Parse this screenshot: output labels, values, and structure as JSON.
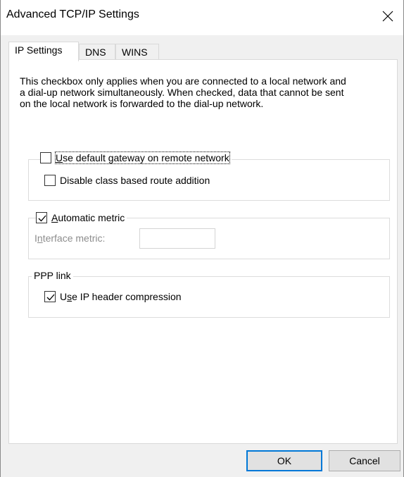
{
  "window": {
    "title": "Advanced TCP/IP Settings",
    "close_icon": "close-icon"
  },
  "tabs": [
    {
      "label": "IP Settings",
      "active": true
    },
    {
      "label": "DNS",
      "active": false
    },
    {
      "label": "WINS",
      "active": false
    }
  ],
  "description": "This checkbox only applies when you are connected to a local network and a dial-up network simultaneously.  When checked, data that cannot be sent on the local network is forwarded to the dial-up network.",
  "gateway_group": {
    "use_default_gateway": {
      "pre": "",
      "mnemonic": "U",
      "post": "se default gateway on remote network",
      "checked": false
    },
    "disable_class_route": {
      "label": "Disable class based route addition",
      "checked": false
    }
  },
  "metric_group": {
    "automatic_metric": {
      "pre": "",
      "mnemonic": "A",
      "post": "utomatic metric",
      "checked": true
    },
    "interface_metric": {
      "pre": "I",
      "mnemonic": "n",
      "post": "terface metric:",
      "value": ""
    }
  },
  "ppp_group": {
    "legend": "PPP link",
    "ip_header_compression": {
      "pre": "U",
      "mnemonic": "s",
      "post": "e IP header compression",
      "checked": true
    }
  },
  "buttons": {
    "ok": "OK",
    "cancel": "Cancel"
  },
  "colors": {
    "accent": "#0078d7",
    "disabled_text": "#8d8d8d"
  }
}
